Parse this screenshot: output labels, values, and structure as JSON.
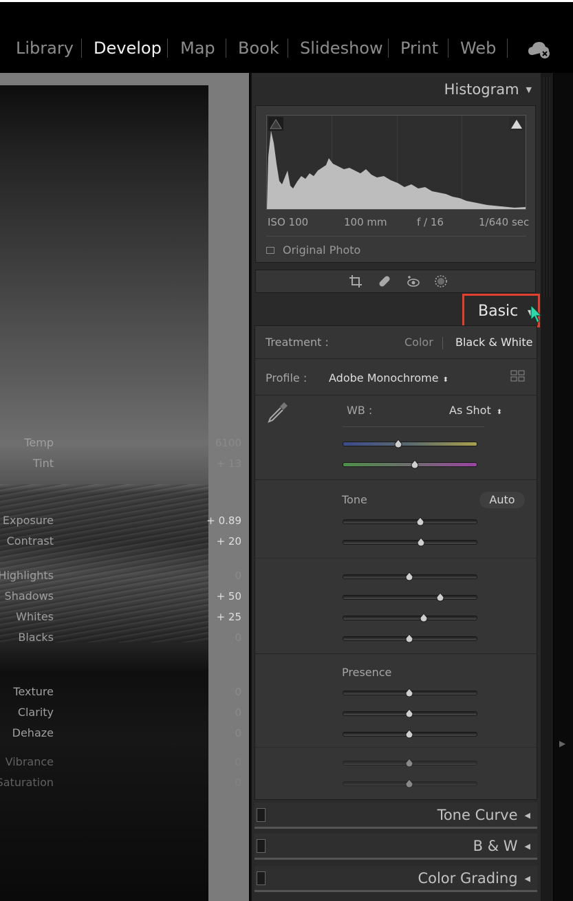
{
  "modules": [
    "Library",
    "Develop",
    "Map",
    "Book",
    "Slideshow",
    "Print",
    "Web"
  ],
  "active_module": "Develop",
  "cloud_icon": "cloud-sync-icon",
  "histogram": {
    "title": "Histogram",
    "iso": "ISO 100",
    "focal": "100 mm",
    "aperture": "f / 16",
    "shutter": "1/640 sec",
    "original_photo": "Original Photo"
  },
  "tool_icons": [
    "crop-icon",
    "healing-icon",
    "red-eye-icon",
    "mask-icon"
  ],
  "basic": {
    "title": "Basic",
    "treatment_label": "Treatment :",
    "treatment_color": "Color",
    "treatment_bw": "Black & White",
    "profile_label": "Profile :",
    "profile_value": "Adobe Monochrome",
    "wb_label": "WB :",
    "wb_value": "As Shot",
    "tone_label": "Tone",
    "auto_label": "Auto",
    "presence_label": "Presence",
    "sliders": {
      "temp": {
        "label": "Temp",
        "value": "6100",
        "pos": 0.42
      },
      "tint": {
        "label": "Tint",
        "value": "+ 13",
        "pos": 0.54
      },
      "exposure": {
        "label": "Exposure",
        "value": "+ 0.89",
        "pos": 0.58
      },
      "contrast": {
        "label": "Contrast",
        "value": "+ 20",
        "pos": 0.59
      },
      "highlights": {
        "label": "Highlights",
        "value": "0",
        "pos": 0.5
      },
      "shadows": {
        "label": "Shadows",
        "value": "+ 50",
        "pos": 0.73
      },
      "whites": {
        "label": "Whites",
        "value": "+ 25",
        "pos": 0.61
      },
      "blacks": {
        "label": "Blacks",
        "value": "0",
        "pos": 0.5
      },
      "texture": {
        "label": "Texture",
        "value": "0",
        "pos": 0.5
      },
      "clarity": {
        "label": "Clarity",
        "value": "0",
        "pos": 0.5
      },
      "dehaze": {
        "label": "Dehaze",
        "value": "0",
        "pos": 0.5
      },
      "vibrance": {
        "label": "Vibrance",
        "value": "0",
        "pos": 0.5
      },
      "saturation": {
        "label": "Saturation",
        "value": "0",
        "pos": 0.5
      }
    }
  },
  "collapsed_panels": [
    "Tone Curve",
    "B & W",
    "Color Grading"
  ],
  "colors": {
    "highlight_border": "#e2402f",
    "cursor": "#2fd6a8"
  }
}
